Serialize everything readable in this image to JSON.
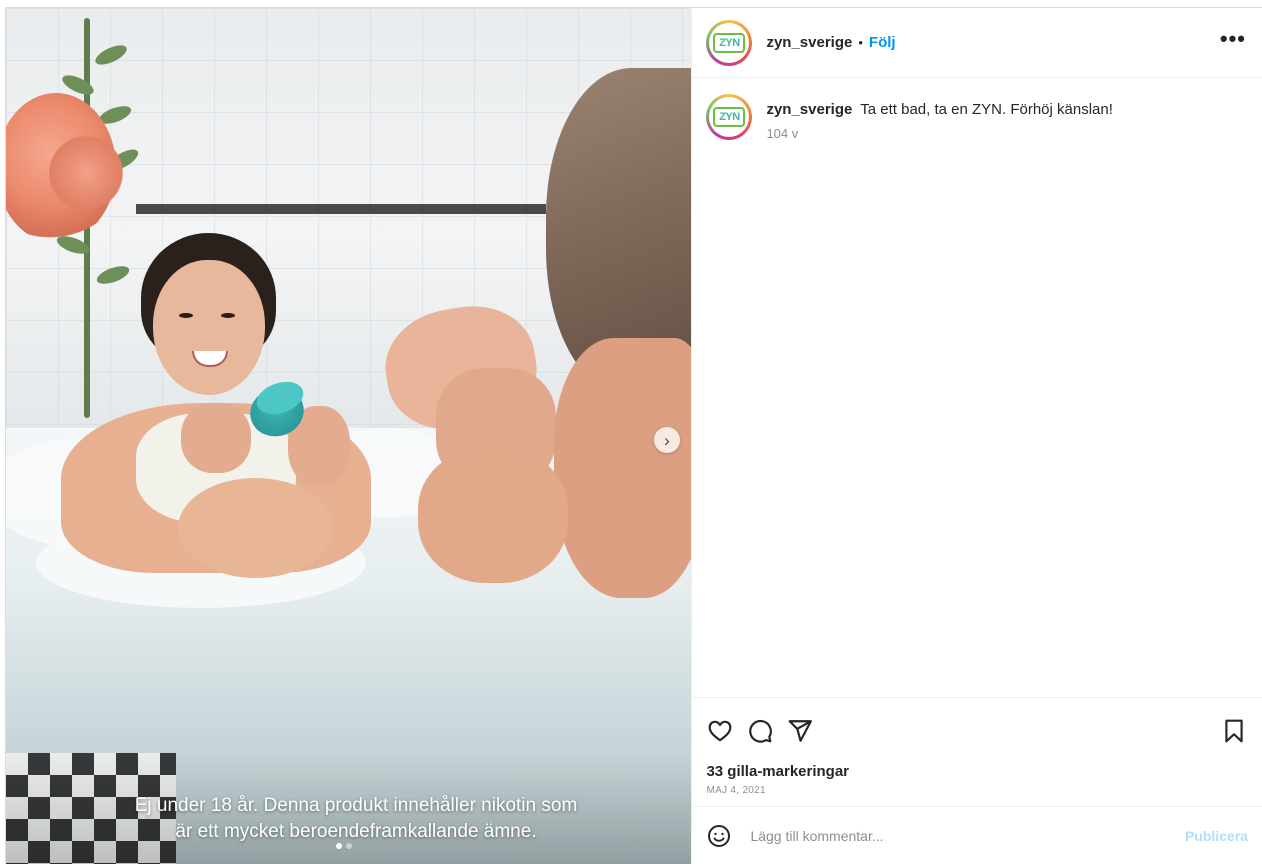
{
  "post": {
    "username": "zyn_sverige",
    "avatar_label": "ZYN",
    "separator": "•",
    "follow_label": "Följ",
    "more_label": "•••",
    "caption_text": "Ta ett bad, ta en ZYN. Förhöj känslan!",
    "caption_time": "104 v",
    "likes": "33 gilla-markeringar",
    "date": "MAJ 4, 2021"
  },
  "media": {
    "overlay_line1": "Ej under 18 år. Denna produkt innehåller nikotin som",
    "overlay_line2": "är ett mycket beroendeframkallande ämne.",
    "next_label": "›",
    "carousel_total": 2,
    "carousel_active": 1
  },
  "comment_bar": {
    "placeholder": "Lägg till kommentar...",
    "publish_label": "Publicera"
  },
  "icons": {
    "like": "heart-icon",
    "comment": "comment-icon",
    "share": "send-icon",
    "save": "bookmark-icon",
    "emoji": "emoji-icon"
  },
  "colors": {
    "accent": "#0095f6",
    "publish_disabled": "#b2dffc",
    "muted": "#8e8e8e",
    "text": "#262626"
  }
}
